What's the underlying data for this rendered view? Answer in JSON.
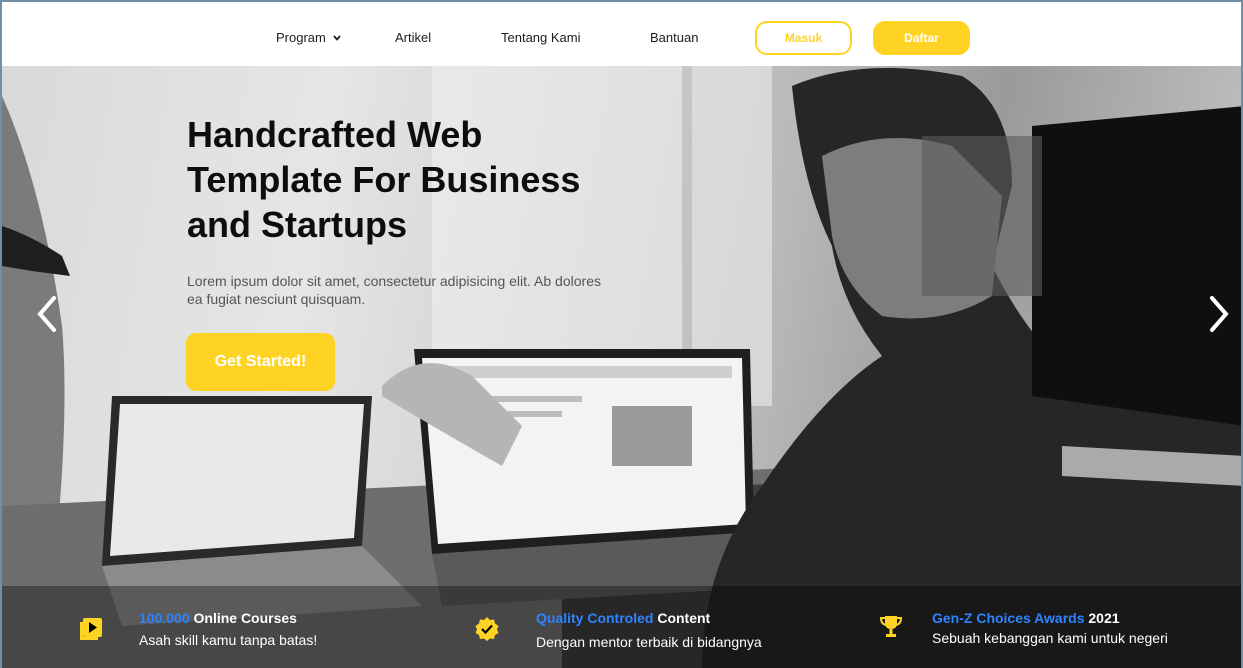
{
  "nav": {
    "items": [
      {
        "label": "Program",
        "has_dropdown": true
      },
      {
        "label": "Artikel"
      },
      {
        "label": "Tentang Kami"
      },
      {
        "label": "Bantuan"
      }
    ],
    "login_label": "Masuk",
    "register_label": "Daftar"
  },
  "hero": {
    "title": "Handcrafted Web Template For Business and Startups",
    "subtitle": "Lorem ipsum dolor sit amet, consectetur adipisicing elit. Ab dolores ea fugiat nesciunt quisquam.",
    "cta_label": "Get Started!"
  },
  "features": [
    {
      "icon": "play-video-icon",
      "title_highlight": "100.000",
      "title_rest": " Online Courses",
      "desc": "Asah skill kamu tanpa batas!"
    },
    {
      "icon": "verified-badge-icon",
      "title_highlight": "Quality Controled",
      "title_rest": " Content",
      "desc": "Dengan mentor terbaik di bidangnya"
    },
    {
      "icon": "trophy-icon",
      "title_highlight": "Gen-Z Choices Awards",
      "title_rest": " 2021",
      "desc": "Sebuah kebanggan kami untuk negeri"
    }
  ],
  "colors": {
    "accent": "#ffd324",
    "highlight": "#2e83ff"
  }
}
